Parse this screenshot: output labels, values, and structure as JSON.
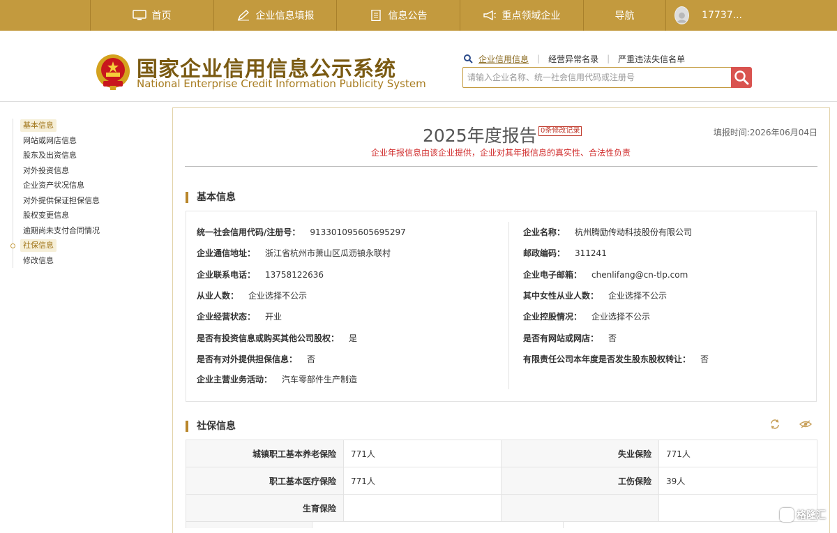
{
  "nav": {
    "items": [
      {
        "label": "首页",
        "icon": "monitor-icon"
      },
      {
        "label": "企业信息填报",
        "icon": "pen-icon"
      },
      {
        "label": "信息公告",
        "icon": "document-icon"
      },
      {
        "label": "重点领域企业",
        "icon": "megaphone-icon"
      },
      {
        "label": "导航",
        "icon": ""
      }
    ],
    "user": "17737..."
  },
  "header": {
    "title_cn": "国家企业信用信息公示系统",
    "title_en": "National Enterprise Credit Information Publicity System",
    "quick_links": [
      "企业信用信息",
      "经营异常名录",
      "严重违法失信名单"
    ],
    "search_placeholder": "请输入企业名称、统一社会信用代码或注册号"
  },
  "sidebar": {
    "items": [
      "基本信息",
      "网站或网店信息",
      "股东及出资信息",
      "对外投资信息",
      "企业资产状况信息",
      "对外提供保证担保信息",
      "股权变更信息",
      "逾期尚未支付合同情况",
      "社保信息",
      "修改信息"
    ],
    "active": [
      "基本信息",
      "社保信息"
    ]
  },
  "report": {
    "title": "2025年度报告",
    "modify_badge": "0条修改记录",
    "filing_time": "填报时间:2026年06月04日",
    "disclaimer": "企业年报信息由该企业提供，企业对其年报信息的真实性、合法性负责"
  },
  "basic_info": {
    "section_title": "基本信息",
    "left": [
      {
        "label": "统一社会信用代码/注册号：",
        "value": "913301095605695297"
      },
      {
        "label": "企业通信地址：",
        "value": "浙江省杭州市萧山区瓜沥镇永联村"
      },
      {
        "label": "企业联系电话：",
        "value": "13758122636"
      },
      {
        "label": "从业人数：",
        "value": "企业选择不公示"
      },
      {
        "label": "企业经营状态：",
        "value": "开业"
      },
      {
        "label": "是否有投资信息或购买其他公司股权：",
        "value": "是"
      },
      {
        "label": "是否有对外提供担保信息：",
        "value": "否"
      },
      {
        "label": "企业主营业务活动：",
        "value": "汽车零部件生产制造"
      }
    ],
    "right": [
      {
        "label": "企业名称：",
        "value": "杭州腾励传动科技股份有限公司"
      },
      {
        "label": "邮政编码：",
        "value": "311241"
      },
      {
        "label": "企业电子邮箱：",
        "value": "chenlifang@cn-tlp.com"
      },
      {
        "label": "其中女性从业人数：",
        "value": "企业选择不公示"
      },
      {
        "label": "企业控股情况：",
        "value": "企业选择不公示"
      },
      {
        "label": "是否有网站或网店：",
        "value": "否"
      },
      {
        "label": "有限责任公司本年度是否发生股东股权转让：",
        "value": "否"
      }
    ]
  },
  "social_insurance": {
    "section_title": "社保信息",
    "rows": [
      [
        {
          "label": "城镇职工基本养老保险",
          "value": "771人"
        },
        {
          "label": "失业保险",
          "value": "771人"
        }
      ],
      [
        {
          "label": "职工基本医疗保险",
          "value": "771人"
        },
        {
          "label": "工伤保险",
          "value": "39人"
        }
      ],
      [
        {
          "label": "生育保险",
          "value": ""
        },
        {
          "label": "",
          "value": ""
        }
      ]
    ]
  },
  "watermark": "格隆汇",
  "colors": {
    "nav_bg": "#c39a3e",
    "title_brown": "#7a5a12",
    "accent_red": "#d02c2c",
    "search_btn": "#d9534f"
  }
}
